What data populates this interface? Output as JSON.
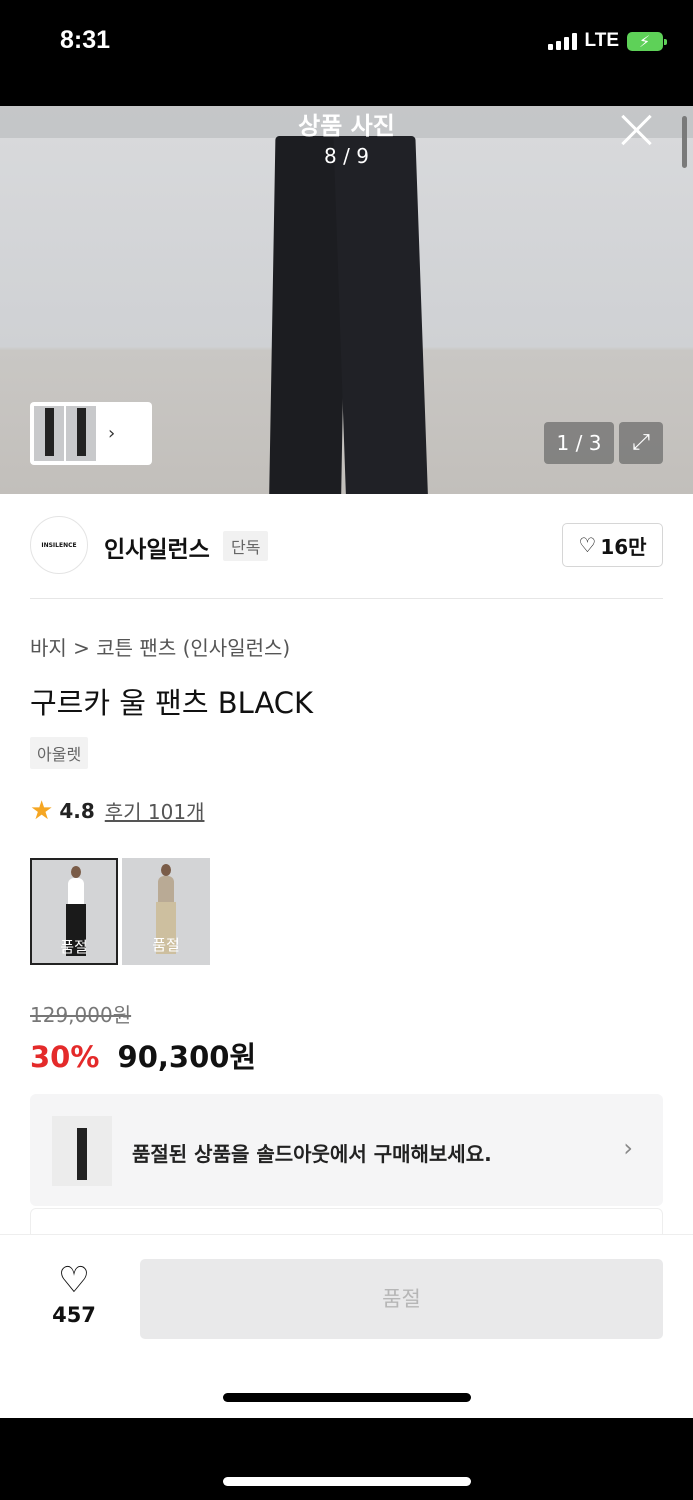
{
  "status": {
    "time": "8:31",
    "network": "LTE"
  },
  "viewer": {
    "title": "상품 사진",
    "counter": "8 / 9",
    "page_badge": "1 / 3"
  },
  "brand": {
    "logo_text": "INSILENCE",
    "name": "인사일런스",
    "tag": "단독",
    "likes": "16만"
  },
  "product": {
    "breadcrumb": "바지 > 코튼 팬츠 (인사일런스)",
    "title": "구르카 울 팬츠 BLACK",
    "tag": "아울렛",
    "rating": "4.8",
    "reviews": "후기 101개",
    "options": [
      {
        "label": "품절",
        "top_color": "#ffffff",
        "bottom_color": "#1a1a1a"
      },
      {
        "label": "품절",
        "top_color": "#b9aa95",
        "bottom_color": "#cdbf9f"
      }
    ],
    "original_price": "129,000원",
    "discount": "30%",
    "sale_price": "90,300원"
  },
  "banner": {
    "text": "품절된 상품을 솔드아웃에서 구매해보세요."
  },
  "bottom": {
    "wish_count": "457",
    "buy_label": "품절"
  },
  "colors": {
    "discount": "#e42a2a",
    "star": "#f5a623",
    "battery": "#5ed158"
  }
}
